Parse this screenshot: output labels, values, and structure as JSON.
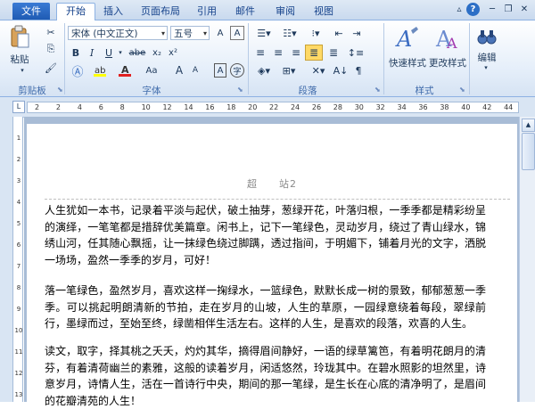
{
  "tabs": {
    "file": "文件",
    "home": "开始",
    "insert": "插入",
    "layout": "页面布局",
    "references": "引用",
    "mailings": "邮件",
    "review": "审阅",
    "view": "视图"
  },
  "ribbon": {
    "paste_label": "粘贴",
    "font_name": "宋体 (中文正文)",
    "font_size": "五号",
    "group_clipboard": "剪贴板",
    "group_font": "字体",
    "group_paragraph": "段落",
    "group_styles": "样式",
    "group_editing": "编辑",
    "quick_styles": "快速样式",
    "change_styles": "更改样式",
    "editing": "编辑",
    "bold": "B",
    "italic": "I",
    "underline": "U",
    "strike": "abe",
    "subscript": "x₂",
    "superscript": "x²",
    "font_color_a": "A",
    "aa": "Aa",
    "grow": "A",
    "shrink": "A",
    "wen": "wén",
    "char_border": "A",
    "char_circle": "字"
  },
  "ruler": {
    "ticks": [
      "2",
      "2",
      "4",
      "6",
      "8",
      "10",
      "12",
      "14",
      "16",
      "18",
      "20",
      "22",
      "24",
      "26",
      "28",
      "30",
      "32",
      "34",
      "36",
      "38",
      "40",
      "42",
      "44"
    ],
    "vticks": [
      "1",
      "2",
      "3",
      "4",
      "5",
      "6",
      "7",
      "8",
      "9",
      "10",
      "11",
      "12",
      "13"
    ],
    "corner": "L"
  },
  "document": {
    "header": "超　　站2",
    "paragraphs": [
      "人生犹如一本书，记录着平淡与起伏，破土抽芽，葱绿开花，叶落归根，一季季都是精彩纷呈的演绎，一笔笔都是措辞优美篇章。闲书上，记下一笔绿色，灵动岁月，绕过了青山绿水，锦绣山河，任其随心飘摇，让一抹绿色绕过脚蹒，透过指间，于明媚下，铺着月光的文字，洒脱一场场，盈然一季季的岁月，可好！",
      "落一笔绿色，盈然岁月，喜欢这样一掬绿水，一篮绿色，默默长成一树的景致，郁郁葱葱一季季。可以挑起明朗清新的节拍，走在岁月的山坡，人生的草原，一园绿意绕着每段，翠绿前行，墨绿而过，至始至终，绿凿相伴生活左右。这样的人生，是喜欢的段落，欢喜的人生。",
      "读文，取字，择其桃之夭夭，灼灼其华，摘得眉间静好，一语的绿草篱笆，有着明花朗月的清芬，有着清荷幽兰的素雅，这般的读着岁月，闲适悠然，玲珑其中。在碧水照影的坦然里，诗意岁月，诗情人生，活在一首诗行中央，期间的那一笔绿，是生长在心底的清净明了，是眉间的花瓣清苑的人生！"
    ]
  }
}
